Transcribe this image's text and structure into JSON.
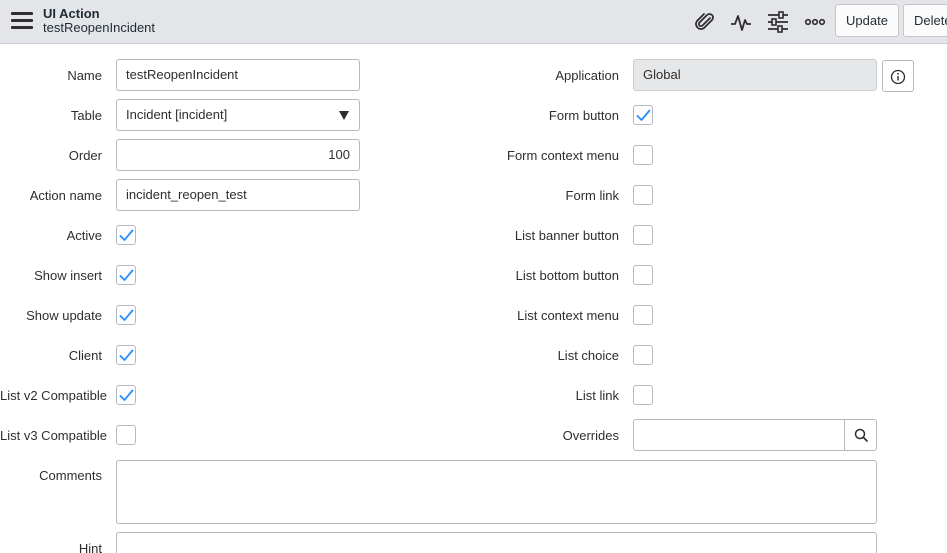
{
  "header": {
    "record_type": "UI Action",
    "record_name": "testReopenIncident",
    "icons": [
      "menu-icon",
      "paperclip-icon",
      "activity-icon",
      "sliders-icon",
      "more-icon"
    ],
    "update_label": "Update",
    "delete_label": "Delete"
  },
  "left_fields": {
    "name": {
      "label": "Name",
      "value": "testReopenIncident"
    },
    "table": {
      "label": "Table",
      "value": "Incident [incident]"
    },
    "order": {
      "label": "Order",
      "value": "100"
    },
    "action_name": {
      "label": "Action name",
      "value": "incident_reopen_test"
    },
    "active": {
      "label": "Active",
      "checked": true
    },
    "show_insert": {
      "label": "Show insert",
      "checked": true
    },
    "show_update": {
      "label": "Show update",
      "checked": true
    },
    "client": {
      "label": "Client",
      "checked": true
    },
    "list_v2": {
      "label": "List v2 Compatible",
      "checked": true
    },
    "list_v3": {
      "label": "List v3 Compatible",
      "checked": false
    }
  },
  "right_fields": {
    "application": {
      "label": "Application",
      "value": "Global"
    },
    "form_button": {
      "label": "Form button",
      "checked": true
    },
    "form_context_menu": {
      "label": "Form context menu",
      "checked": false
    },
    "form_link": {
      "label": "Form link",
      "checked": false
    },
    "list_banner_button": {
      "label": "List banner button",
      "checked": false
    },
    "list_bottom_button": {
      "label": "List bottom button",
      "checked": false
    },
    "list_context_menu": {
      "label": "List context menu",
      "checked": false
    },
    "list_choice": {
      "label": "List choice",
      "checked": false
    },
    "list_link": {
      "label": "List link",
      "checked": false
    },
    "overrides": {
      "label": "Overrides",
      "value": ""
    }
  },
  "comments": {
    "label": "Comments",
    "value": ""
  },
  "hint": {
    "label": "Hint",
    "value": ""
  },
  "colors": {
    "check": "#278efc",
    "header_bg": "#e3e5e8",
    "border": "#b6b9bf"
  }
}
